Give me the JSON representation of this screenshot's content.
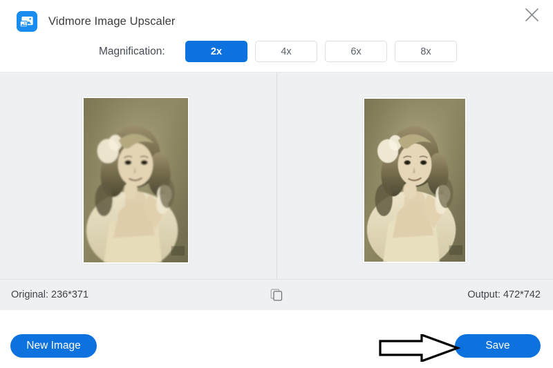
{
  "window": {
    "title": "Vidmore Image Upscaler",
    "logo_icon": "image-upscaler-logo-icon",
    "close_icon": "close-icon"
  },
  "magnification": {
    "label": "Magnification:",
    "selected": "2x",
    "options": [
      {
        "label": "2x",
        "selected": true
      },
      {
        "label": "4x",
        "selected": false
      },
      {
        "label": "6x",
        "selected": false
      },
      {
        "label": "8x",
        "selected": false
      }
    ]
  },
  "preview": {
    "left": {
      "alt": "Original sepia vintage portrait photograph of a young girl with curly hair and white hair bow"
    },
    "right": {
      "alt": "Upscaled sepia vintage portrait photograph of a young girl with curly hair and white hair bow"
    }
  },
  "status": {
    "original_label": "Original: 236*371",
    "output_label": "Output: 472*742",
    "compare_icon": "compare-duplicate-icon"
  },
  "footer": {
    "new_image_label": "New Image",
    "save_label": "Save"
  },
  "annotation": {
    "arrow_icon": "right-arrow-annotation-icon"
  },
  "colors": {
    "accent_blue": "#0d72dd",
    "logo_blue": "#1a8cf0",
    "panel_gray": "#eef0f1",
    "text_dark": "#3f444a",
    "border_gray": "#dcdfe3"
  }
}
